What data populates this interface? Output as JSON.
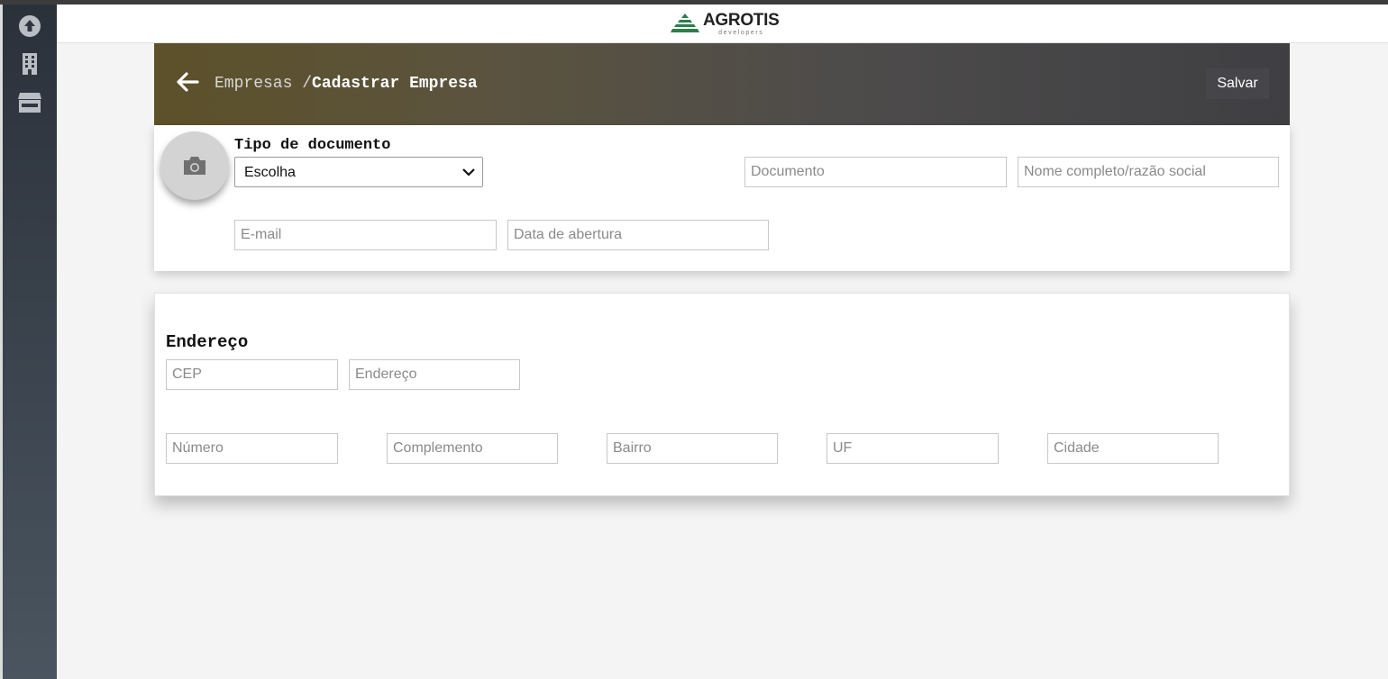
{
  "app": {
    "brand": "AGROTIS",
    "brand_sub": "developers"
  },
  "sidebar": {
    "items": [
      {
        "icon": "upload-circle-icon"
      },
      {
        "icon": "building-icon"
      },
      {
        "icon": "store-icon"
      }
    ]
  },
  "header": {
    "breadcrumb_parent": "Empresas",
    "breadcrumb_sep": "/",
    "breadcrumb_current": "Cadastrar Empresa",
    "save_label": "Salvar",
    "colors": {
      "gradient_start": "#5c5129",
      "gradient_end": "#3f3f43"
    }
  },
  "company_form": {
    "doc_type_label": "Tipo de documento",
    "doc_type_value": "Escolha",
    "document_placeholder": "Documento",
    "name_placeholder": "Nome completo/razão social",
    "email_placeholder": "E-mail",
    "opening_date_placeholder": "Data de abertura"
  },
  "address_form": {
    "title": "Endereço",
    "cep_placeholder": "CEP",
    "address_placeholder": "Endereço",
    "number_placeholder": "Número",
    "complement_placeholder": "Complemento",
    "district_placeholder": "Bairro",
    "state_placeholder": "UF",
    "city_placeholder": "Cidade"
  }
}
